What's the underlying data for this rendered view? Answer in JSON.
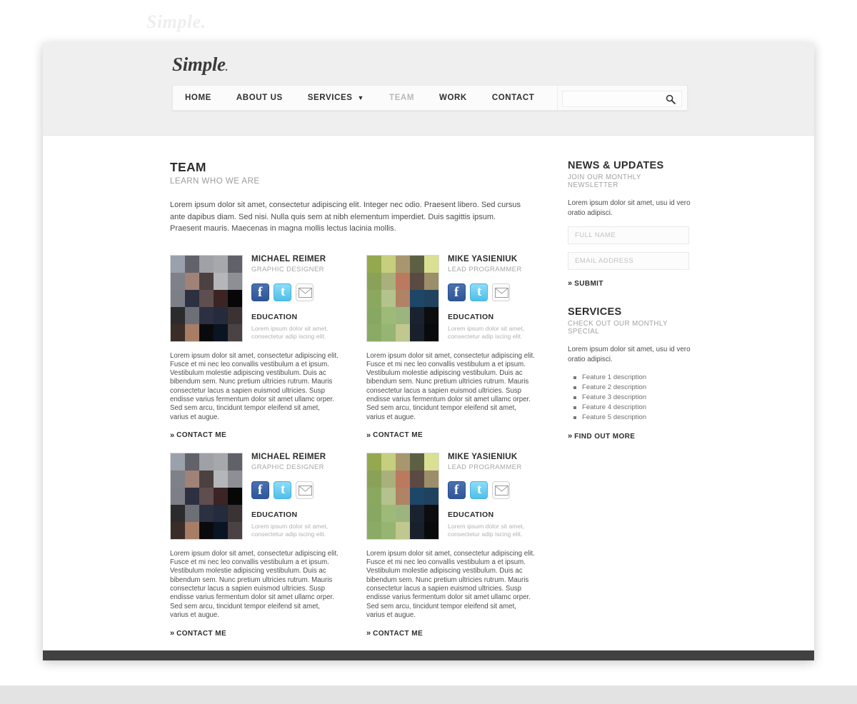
{
  "watermark": {
    "top_text": "Simple."
  },
  "header": {
    "logo": "Simple",
    "logo_dot": ".",
    "nav": [
      {
        "label": "HOME",
        "state": "normal",
        "has_caret": false
      },
      {
        "label": "ABOUT US",
        "state": "normal",
        "has_caret": false
      },
      {
        "label": "SERVICES",
        "state": "normal",
        "has_caret": true
      },
      {
        "label": "TEAM",
        "state": "disabled",
        "has_caret": false
      },
      {
        "label": "WORK",
        "state": "normal",
        "has_caret": false
      },
      {
        "label": "CONTACT",
        "state": "normal",
        "has_caret": false
      }
    ],
    "search": {
      "value": "",
      "placeholder": "",
      "icon": "search-icon"
    }
  },
  "main": {
    "title": "TEAM",
    "subtitle": "LEARN WHO WE ARE",
    "intro": "Lorem ipsum dolor sit amet, consectetur adipiscing elit. Integer nec odio. Praesent libero. Sed cursus ante dapibus diam. Sed nisi. Nulla quis sem at nibh elementum imperdiet. Duis sagittis ipsum. Praesent mauris. Maecenas in magna mollis lectus lacinia mollis.",
    "education_label": "EDUCATION",
    "education_body": "Lorem ipsum dolor sit amet, consectetur adip iscing elit.",
    "bio": "Lorem ipsum dolor sit amet, consectetur adipiscing elit. Fusce et mi nec leo convallis vestibulum a et ipsum. Vestibulum molestie adipiscing vestibulum. Duis ac bibendum sem. Nunc pretium ultricies rutrum. Mauris consectetur lacus a sapien euismod ultricies. Susp endisse varius fermentum dolor sit amet ullamc orper. Sed sem arcu, tincidunt tempor eleifend sit amet, varius et augue.",
    "contact_link": "CONTACT ME",
    "chevron": "»",
    "members": [
      {
        "name": "MICHAEL REIMER",
        "role": "GRAPHIC DESIGNER",
        "palette": "grey",
        "socials": [
          "facebook-icon",
          "twitter-icon",
          "email-icon"
        ],
        "mosaic": [
          "#9aa0ac",
          "#62626a",
          "#9fa1a6",
          "#a7a8ac",
          "#616169",
          "#7e8187",
          "#a08277",
          "#4b4140",
          "#b5b6ba",
          "#8e8f95",
          "#7c7f86",
          "#2c3040",
          "#5e4e4f",
          "#3b2423",
          "#070708",
          "#2b2a2c",
          "#6c6f75",
          "#2b3141",
          "#232b3c",
          "#3b3234",
          "#3a2c27",
          "#a77d66",
          "#0a0a0c",
          "#0b1423",
          "#4b4244",
          "#5b4338"
        ]
      },
      {
        "name": "MIKE YASIENIUK",
        "role": "LEAD PROGRAMMER",
        "palette": "green",
        "socials": [
          "facebook-icon",
          "twitter-icon",
          "email-icon"
        ],
        "mosaic": [
          "#94a84f",
          "#c5cf7e",
          "#a8976e",
          "#5d6043",
          "#dbdf93",
          "#8aa257",
          "#a9b07c",
          "#bb7a5f",
          "#5a4a43",
          "#9b8e69",
          "#8ba85f",
          "#b4c38d",
          "#b08365",
          "#1e4668",
          "#20425e",
          "#86a862",
          "#9dba78",
          "#9cb47e",
          "#1a2230",
          "#0d0d10",
          "#8aab66",
          "#96b472",
          "#c0c78f",
          "#19202c",
          "#090a0c"
        ]
      }
    ]
  },
  "sidebar": {
    "news": {
      "title": "NEWS & UPDATES",
      "subtitle": "JOIN OUR MONTHLY NEWSLETTER",
      "body": "Lorem ipsum dolor sit amet, usu id vero oratio adipisci.",
      "name_value": "",
      "name_placeholder": "FULL NAME",
      "email_value": "",
      "email_placeholder": "EMAIL ADDRESS",
      "submit_label": "SUBMIT"
    },
    "services": {
      "title": "SERVICES",
      "subtitle": "CHECK OUT OUR MONTHLY SPECIAL",
      "body": "Lorem ipsum dolor sit amet, usu id vero oratio adipisci.",
      "features": [
        "Feature 1 description",
        "Feature 2 description",
        "Feature 3 description",
        "Feature 4 description",
        "Feature 5 description"
      ],
      "more_label": "FIND OUT MORE"
    },
    "chevron": "»"
  },
  "colors": {
    "page_header_bg": "#efefef",
    "facebook_blue": "#3b5998",
    "twitter_blue": "#5ec9ee",
    "footer_dark": "#414141",
    "text_dark": "#2e2e2e",
    "text_muted": "#a2a2a2"
  }
}
